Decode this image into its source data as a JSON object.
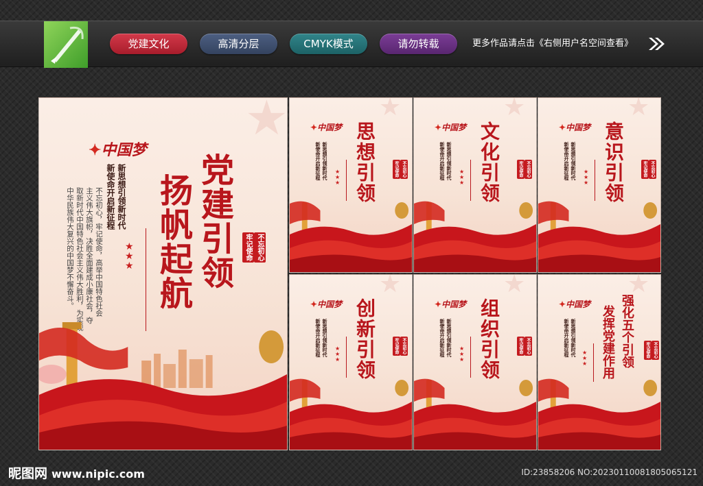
{
  "toolbar": {
    "tags": [
      "党建文化",
      "高清分层",
      "CMYK模式",
      "请勿转载"
    ],
    "more_text": "更多作品请点击《右侧用户名空间查看》",
    "colors": {
      "red": "#c1283a",
      "blue": "#3e4f70",
      "teal": "#257277",
      "purple": "#6a3184"
    }
  },
  "main_poster": {
    "logo": "中国梦",
    "title_line1": "党建引领",
    "title_line2": "扬帆起航",
    "sub_line1": "新思想引领新时代",
    "sub_line2": "新使命开启新征程",
    "body_lines": [
      "不忘初心，牢记使命，高举中国特色社会",
      "主义伟大旗帜，决胜全面建成小康社会，夺",
      "取新时代中国特色社会主义伟大胜利，为实现",
      "中华民族伟大复兴的中国梦不懈奋斗。"
    ],
    "seal1": "不忘初心",
    "seal2": "牢记使命"
  },
  "small_posters": [
    {
      "title": "思想引领"
    },
    {
      "title": "文化引领"
    },
    {
      "title": "意识引领"
    },
    {
      "title": "创新引领"
    },
    {
      "title": "组织引领"
    },
    {
      "title_line1": "强化五个引领",
      "title_line2": "发挥党建作用"
    }
  ],
  "small_common": {
    "logo": "中国梦",
    "sub_line1": "新思想引领新时代",
    "sub_line2": "新使命开启新征程",
    "seal1": "不忘初心",
    "seal2": "牢记使命"
  },
  "footer": {
    "site_name": "昵图网",
    "site_url": "www.nipic.com",
    "id_text": "ID:23858206 NO:20230110081805065121"
  }
}
